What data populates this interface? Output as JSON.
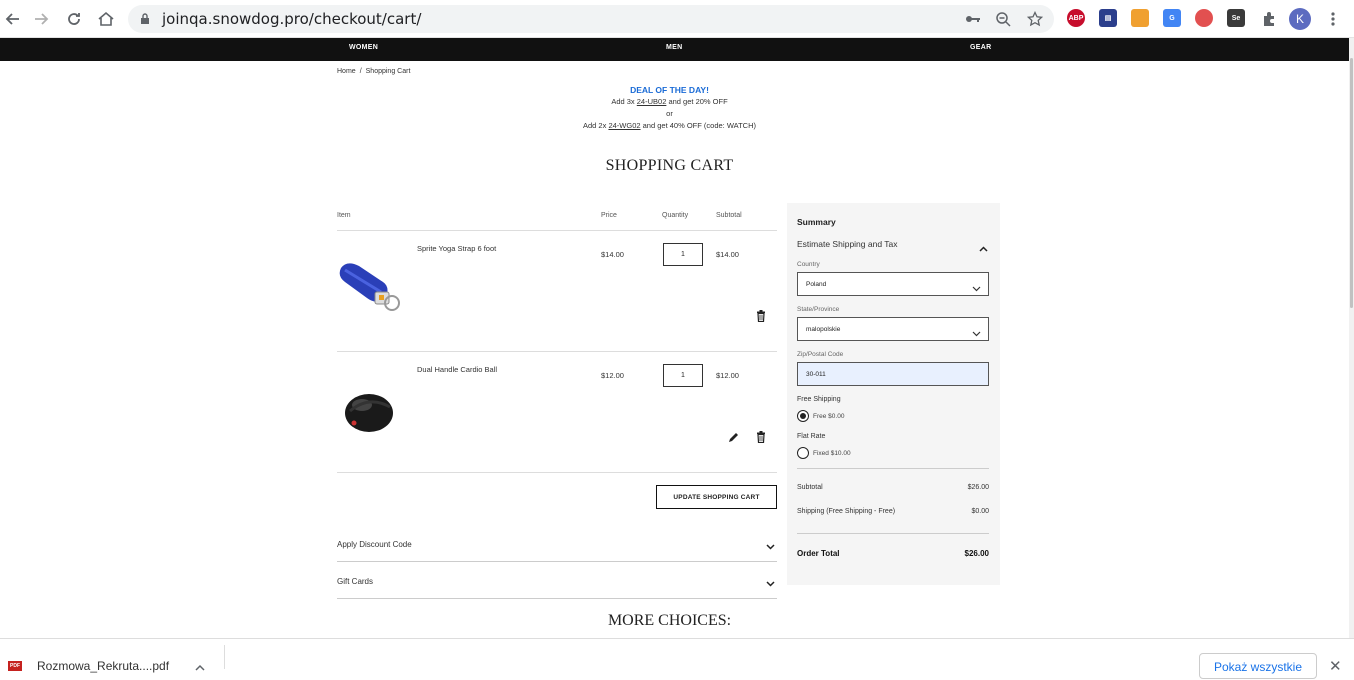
{
  "browser": {
    "url": "joinqa.snowdog.pro/checkout/cart/",
    "profile_initial": "K",
    "extensions": [
      {
        "name": "abp-icon",
        "label": "ABP",
        "color": "#c70d2c"
      },
      {
        "name": "extension-dark-icon",
        "label": "▤",
        "color": "#2b3e8c"
      },
      {
        "name": "image-extension-icon",
        "label": "",
        "color": "#f0a030"
      },
      {
        "name": "translate-icon",
        "label": "G",
        "color": "#4285f4"
      },
      {
        "name": "shield-extension-icon",
        "label": "",
        "color": "#e25050"
      },
      {
        "name": "selenium-icon",
        "label": "Se",
        "color": "#3a3a3a"
      }
    ]
  },
  "nav": {
    "women": "WOMEN",
    "men": "MEN",
    "gear": "GEAR"
  },
  "breadcrumb": {
    "home": "Home",
    "sep": "/",
    "current": "Shopping Cart"
  },
  "deal": {
    "title": "DEAL OF THE DAY!",
    "line1_pre": "Add 3x ",
    "line1_link": "24-UB02",
    "line1_post": " and get 20% OFF",
    "or": "or",
    "line2_pre": "Add 2x ",
    "line2_link": "24-WG02",
    "line2_post": " and get 40% OFF (code: WATCH)"
  },
  "page_title": "SHOPPING CART",
  "columns": {
    "item": "Item",
    "price": "Price",
    "quantity": "Quantity",
    "subtotal": "Subtotal"
  },
  "items": [
    {
      "name": "Sprite Yoga Strap 6 foot",
      "price": "$14.00",
      "qty": "1",
      "subtotal": "$14.00"
    },
    {
      "name": "Dual Handle Cardio Ball",
      "price": "$12.00",
      "qty": "1",
      "subtotal": "$12.00"
    }
  ],
  "update_cart": "UPDATE SHOPPING CART",
  "discount": "Apply Discount Code",
  "gift": "Gift Cards",
  "more_choices": "MORE CHOICES:",
  "summary": {
    "title": "Summary",
    "estimate": "Estimate Shipping and Tax",
    "country_label": "Country",
    "country": "Poland",
    "state_label": "State/Province",
    "state": "malopolskie",
    "zip_label": "Zip/Postal Code",
    "zip": "30-011",
    "free_group": "Free Shipping",
    "free_option": "Free $0.00",
    "flat_group": "Flat Rate",
    "flat_option": "Fixed $10.00",
    "subtotal_label": "Subtotal",
    "subtotal": "$26.00",
    "shipping_label": "Shipping (Free Shipping - Free)",
    "shipping": "$0.00",
    "total_label": "Order Total",
    "total": "$26.00"
  },
  "downloads": {
    "file": "Rozmowa_Rekruta....pdf",
    "file_type": "PDF",
    "show_all": "Pokaż wszystkie"
  }
}
